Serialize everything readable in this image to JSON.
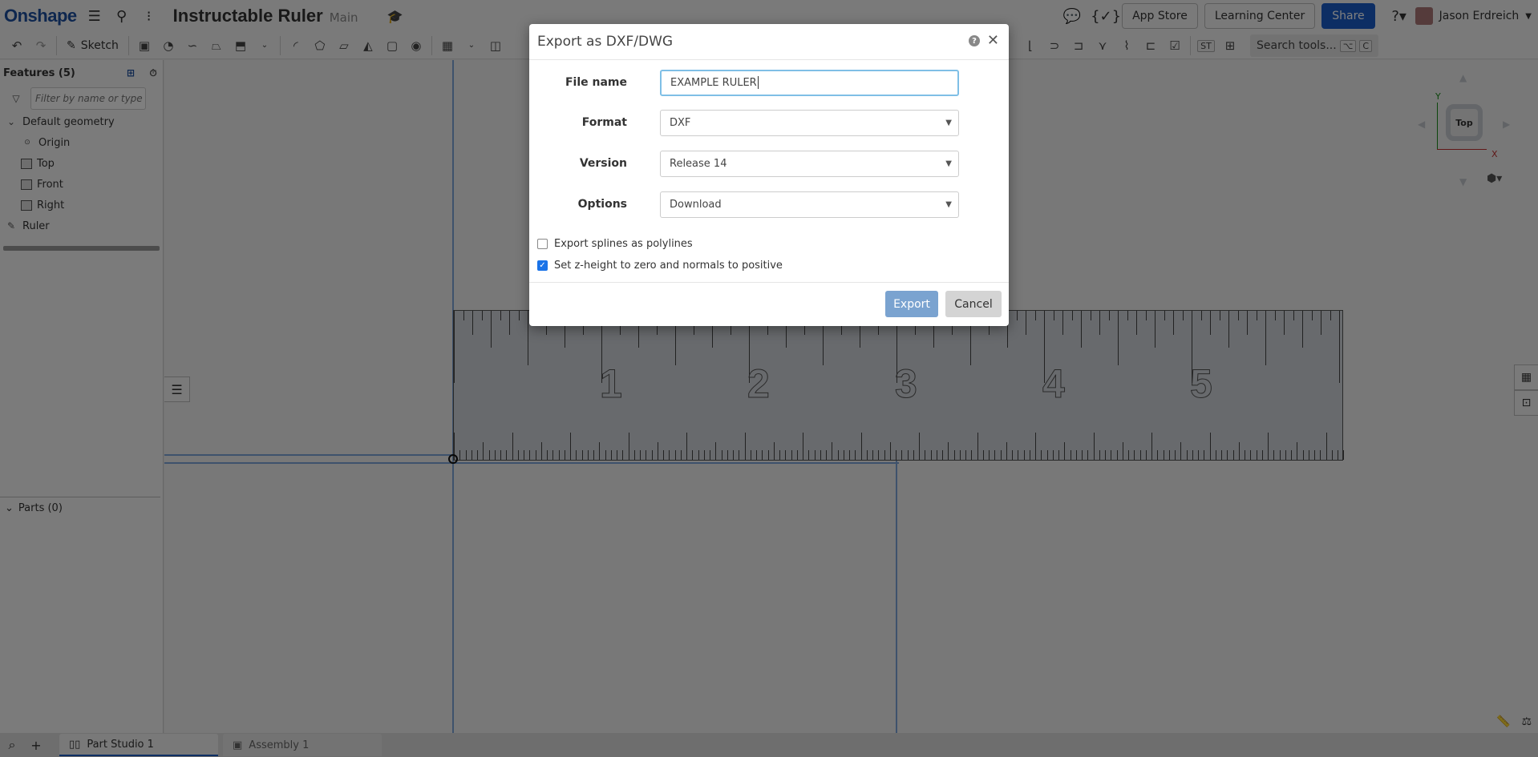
{
  "app": {
    "logo": "Onshape",
    "document_title": "Instructable Ruler",
    "branch": "Main"
  },
  "top_right": {
    "app_store": "App Store",
    "learning_center": "Learning Center",
    "share": "Share",
    "user_name": "Jason Erdreich"
  },
  "toolbar": {
    "sketch_label": "Sketch",
    "search_tools": "Search tools...",
    "search_shortcut_1": "⌥",
    "search_shortcut_2": "C",
    "st_label": "ST"
  },
  "feature_panel": {
    "title": "Features (5)",
    "filter_placeholder": "Filter by name or type",
    "group_label": "Default geometry",
    "items": [
      {
        "label": "Origin",
        "icon": "origin-icon"
      },
      {
        "label": "Top",
        "icon": "plane-icon"
      },
      {
        "label": "Front",
        "icon": "plane-icon"
      },
      {
        "label": "Right",
        "icon": "plane-icon"
      }
    ],
    "sketch_item": "Ruler",
    "parts_label": "Parts (0)"
  },
  "viewport": {
    "view_cube_face": "Top",
    "axis_x": "X",
    "axis_y": "Y",
    "ruler_numbers": [
      "1",
      "2",
      "3",
      "4",
      "5"
    ]
  },
  "tabs": [
    {
      "label": "Part Studio 1",
      "active": true
    },
    {
      "label": "Assembly 1",
      "active": false
    }
  ],
  "dialog": {
    "title": "Export as DXF/DWG",
    "file_name_label": "File name",
    "file_name_value": "EXAMPLE RULER",
    "format_label": "Format",
    "format_value": "DXF",
    "version_label": "Version",
    "version_value": "Release 14",
    "options_label": "Options",
    "options_value": "Download",
    "checkbox_splines_label": "Export splines as polylines",
    "checkbox_splines_checked": false,
    "checkbox_zheight_label": "Set z-height to zero and normals to positive",
    "checkbox_zheight_checked": true,
    "export_button": "Export",
    "cancel_button": "Cancel"
  },
  "colors": {
    "brand": "#1d4e9e",
    "share_button": "#1a5cc8",
    "export_button": "#7aa3d0",
    "focus_border": "#7fbfe6"
  }
}
